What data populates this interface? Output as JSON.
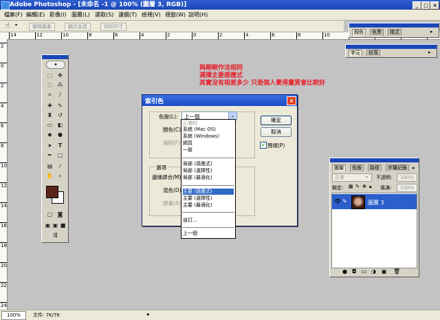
{
  "app": {
    "window_title": "Adobe Photoshop - [未命名 -1 @ 100% (圖層 3, RGB)]"
  },
  "window_controls": {
    "minimize": "_",
    "maximize": "□",
    "close": "×"
  },
  "menubar": {
    "items": [
      "檔案(F)",
      "編輯(E)",
      "影像(I)",
      "圖層(L)",
      "選取(S)",
      "濾鏡(T)",
      "檢視(V)",
      "視窗(W)",
      "說明(H)"
    ]
  },
  "optionsbar": {
    "buttons": [
      "實際像素",
      "顯示全頁",
      "列印尺寸"
    ]
  },
  "rulers": {
    "h_labels": [
      "14",
      "12",
      "10",
      "8",
      "6",
      "4",
      "2",
      "0",
      "2",
      "4",
      "6",
      "8",
      "10",
      "12",
      "14",
      "16",
      "18"
    ],
    "v_labels": [
      "2",
      "0",
      "2",
      "4",
      "6",
      "8",
      "10",
      "12",
      "14",
      "16",
      "18",
      "20",
      "22",
      "24"
    ]
  },
  "status": {
    "zoom": "100%",
    "doc": "文件: 7K/7K"
  },
  "annotation": {
    "lines": [
      "與剛剛作法相同",
      "選擇主要感應式",
      "其實沒有相差多少  只是個人覺得畫質會比較好"
    ]
  },
  "dialog": {
    "title": "索引色",
    "palette_label": "色盤(L):",
    "palette_value": "上一個",
    "colors_label": "顏色(C):",
    "forced_label": "強制(F):",
    "options_group": "選項",
    "matte_label": "邊緣調合(M):",
    "dither_label": "混色(D):",
    "amount_label": "總量(A):",
    "ok": "確定",
    "cancel": "取消",
    "preview": "預視(P)",
    "preview_checked": true
  },
  "palette_options": [
    "正確的",
    "系統 (Mac OS)",
    "系統 (Windows)",
    "網頁",
    "一致",
    "局部 (感應式)",
    "局部 (選擇性)",
    "局部 (最適化)",
    "主要 (感應式)",
    "主要 (選擇性)",
    "主要 (最適化)",
    "自訂...",
    "上一個"
  ],
  "palette_selected": "主要 (感應式)",
  "top_panels": {
    "group1_tabs": [
      "顏色",
      "色票",
      "樣式"
    ],
    "group2_tabs": [
      "字元",
      "段落"
    ]
  },
  "layers_panel": {
    "tabs": [
      "圖層",
      "色版",
      "路徑",
      "步驟記錄"
    ],
    "blend_mode": "正常",
    "opacity_label": "不透明:",
    "opacity_value": "100%",
    "lock_label": "鎖定:",
    "fill_label": "填滿:",
    "fill_value": "100%",
    "layers": [
      {
        "name": "圖層 3",
        "selected": true
      }
    ],
    "colors": {
      "selected_row": "#2c5fcc"
    }
  },
  "colors": {
    "canvas_bg": "#c3c3c3",
    "title_blue": "#1a46b8",
    "annotation_red": "#e8202c",
    "foreground_swatch": "#5a2418",
    "background_swatch": "#ffffff"
  }
}
